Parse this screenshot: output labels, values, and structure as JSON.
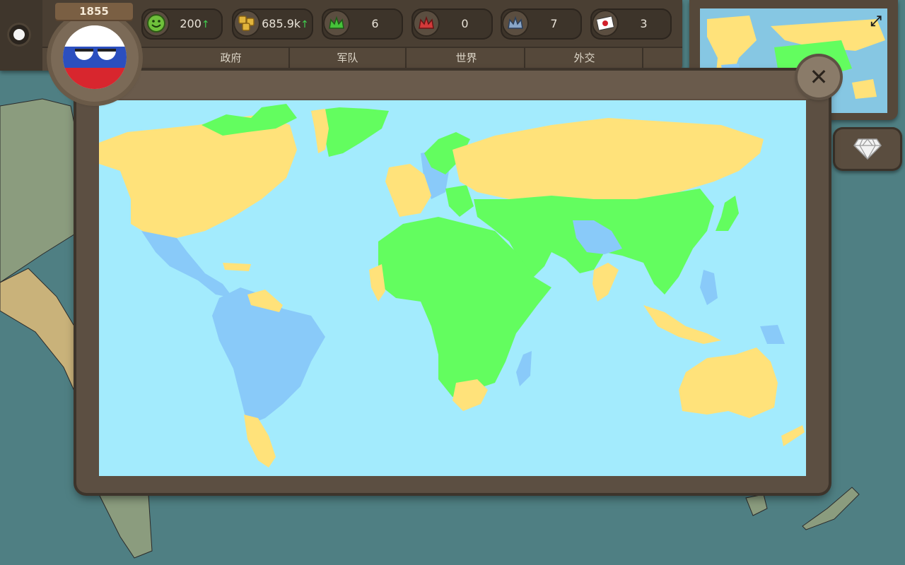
{
  "header": {
    "year": "1855",
    "stats": [
      {
        "name": "happiness",
        "icon": "smiley-icon",
        "value": "200",
        "trend": "↑"
      },
      {
        "name": "gold",
        "icon": "coins-icon",
        "value": "685.9k",
        "trend": "↑"
      },
      {
        "name": "allies",
        "icon": "green-crown-icon",
        "value": "6",
        "trend": ""
      },
      {
        "name": "enemies",
        "icon": "red-crown-icon",
        "value": "0",
        "trend": ""
      },
      {
        "name": "neutral",
        "icon": "blue-crown-icon",
        "value": "7",
        "trend": ""
      },
      {
        "name": "flag",
        "icon": "japan-flag-icon",
        "value": "3",
        "trend": ""
      }
    ],
    "tabs": [
      "政府",
      "军队",
      "世界",
      "外交"
    ]
  },
  "colors": {
    "ocean": "#a3ebfd",
    "green": "#63fd5f",
    "yellow": "#ffe27a",
    "blue": "#89caf9",
    "frame": "#5c4f42"
  },
  "legend_groups": [
    "green",
    "yellow",
    "blue"
  ]
}
